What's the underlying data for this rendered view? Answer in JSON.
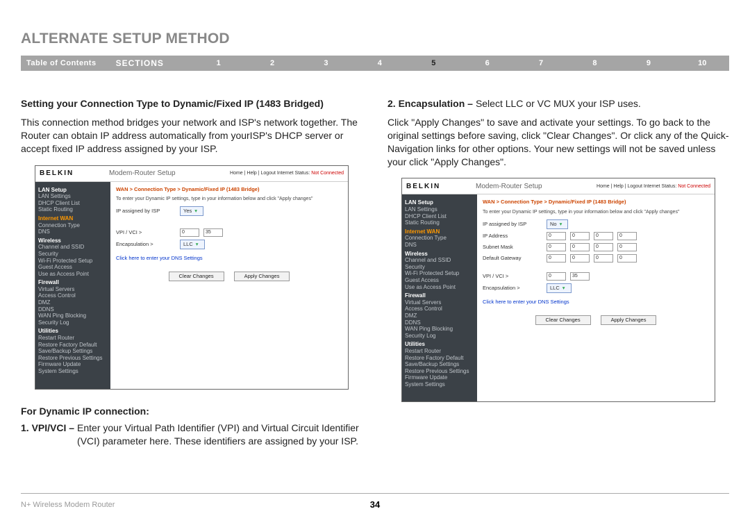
{
  "page": {
    "title": "ALTERNATE SETUP METHOD",
    "toc_label": "Table of Contents",
    "sections_label": "SECTIONS",
    "section_nums": [
      "1",
      "2",
      "3",
      "4",
      "5",
      "6",
      "7",
      "8",
      "9",
      "10"
    ],
    "active_section": "5",
    "footer_product": "N+ Wireless Modem Router",
    "page_number": "34"
  },
  "left": {
    "h1": "Setting your Connection Type to Dynamic/Fixed IP (1483 Bridged)",
    "p1": "This connection method bridges your network and ISP's network together. The Router can obtain IP address automatically from yourISP's DHCP server or accept fixed IP address assigned by your ISP.",
    "sub": "For Dynamic IP connection:",
    "li1_num": "1. VPI/VCI –",
    "li1_txt": "Enter your Virtual Path Identifier (VPI) and Virtual Circuit Identifier (VCI) parameter here. These identifiers are assigned by your ISP."
  },
  "right": {
    "li2_num": "2. Encapsulation –",
    "li2_txt": "Select LLC or VC MUX your ISP uses.",
    "p1": "Click \"Apply Changes\" to save and activate your settings. To go back to the original settings before saving, click \"Clear Changes\". Or click any of the Quick-Navigation links for other options. Your new settings will not be saved unless your click \"Apply Changes\"."
  },
  "shot1": {
    "logo": "BELKIN",
    "title": "Modem-Router Setup",
    "status_links": "Home | Help | Logout   Internet Status:",
    "status_val": "Not Connected",
    "breadcrumb": "WAN > Connection Type > Dynamic/Fixed IP (1483 Bridge)",
    "note": "To enter your Dynamic IP settings, type in your information below and click \"Apply changes\"",
    "f_ip_label": "IP assigned by ISP",
    "f_ip_val": "Yes",
    "f_vpi_label": "VPI / VCI >",
    "f_vpi_a": "0",
    "f_vpi_b": "35",
    "f_enc_label": "Encapsulation >",
    "f_enc_val": "LLC",
    "dns_link": "Click here to enter your DNS Settings",
    "btn_clear": "Clear Changes",
    "btn_apply": "Apply Changes",
    "side": {
      "g1": "LAN Setup",
      "g1_items": [
        "LAN Settings",
        "DHCP Client List",
        "Static Routing"
      ],
      "g2": "Internet WAN",
      "g2_items": [
        "Connection Type",
        "DNS"
      ],
      "g3": "Wireless",
      "g3_items": [
        "Channel and SSID",
        "Security",
        "Wi-Fi Protected Setup",
        "Guest Access",
        "Use as Access Point"
      ],
      "g4": "Firewall",
      "g4_items": [
        "Virtual Servers",
        "Access Control",
        "DMZ",
        "DDNS",
        "WAN Ping Blocking",
        "Security Log"
      ],
      "g5": "Utilities",
      "g5_items": [
        "Restart Router",
        "Restore Factory Default",
        "Save/Backup Settings",
        "Restore Previous Settings",
        "Firmware Update",
        "System Settings"
      ]
    }
  },
  "shot2": {
    "logo": "BELKIN",
    "title": "Modem-Router Setup",
    "status_links": "Home | Help | Logout   Internet Status:",
    "status_val": "Not Connected",
    "breadcrumb": "WAN > Connection Type > Dynamic/Fixed IP (1483 Bridge)",
    "note": "To enter your Dynamic IP settings, type in your information below and click \"Apply changes\"",
    "f_ip_label": "IP assigned by ISP",
    "f_ip_val": "No",
    "f_addr_label": "IP Address",
    "f_mask_label": "Subnet Mask",
    "f_gw_label": "Default Gateway",
    "ip_oct": [
      "0",
      "0",
      "0",
      "0"
    ],
    "f_vpi_label": "VPI / VCI >",
    "f_vpi_a": "0",
    "f_vpi_b": "35",
    "f_enc_label": "Encapsulation >",
    "f_enc_val": "LLC",
    "dns_link": "Click here to enter your DNS Settings",
    "btn_clear": "Clear Changes",
    "btn_apply": "Apply Changes"
  }
}
